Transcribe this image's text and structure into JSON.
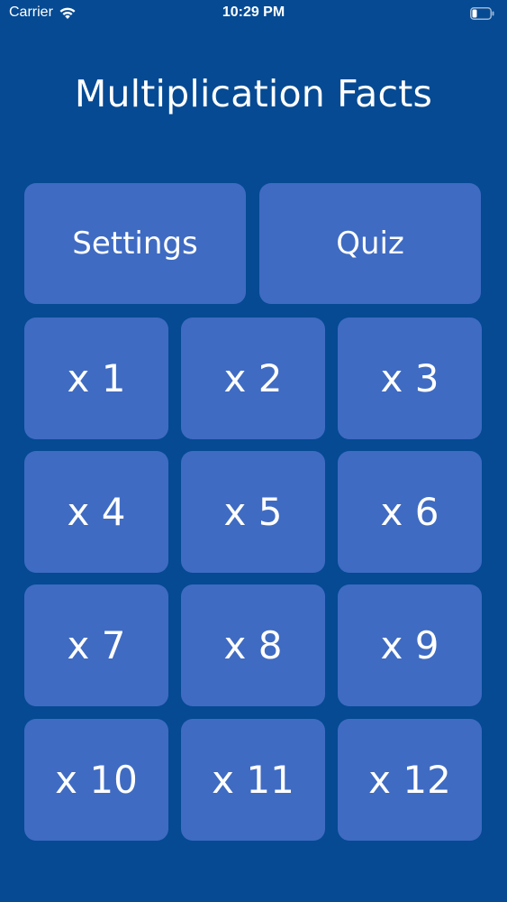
{
  "status_bar": {
    "carrier": "Carrier",
    "time": "10:29 PM",
    "wifi_icon": "wifi-icon",
    "battery_icon": "battery-icon"
  },
  "title": "Multiplication Facts",
  "actions": {
    "settings_label": "Settings",
    "quiz_label": "Quiz"
  },
  "tables": [
    "x 1",
    "x 2",
    "x 3",
    "x 4",
    "x 5",
    "x 6",
    "x 7",
    "x 8",
    "x 9",
    "x 10",
    "x 11",
    "x 12"
  ],
  "colors": {
    "background": "#054a93",
    "tile": "#3f6bc2",
    "text": "#ffffff"
  }
}
